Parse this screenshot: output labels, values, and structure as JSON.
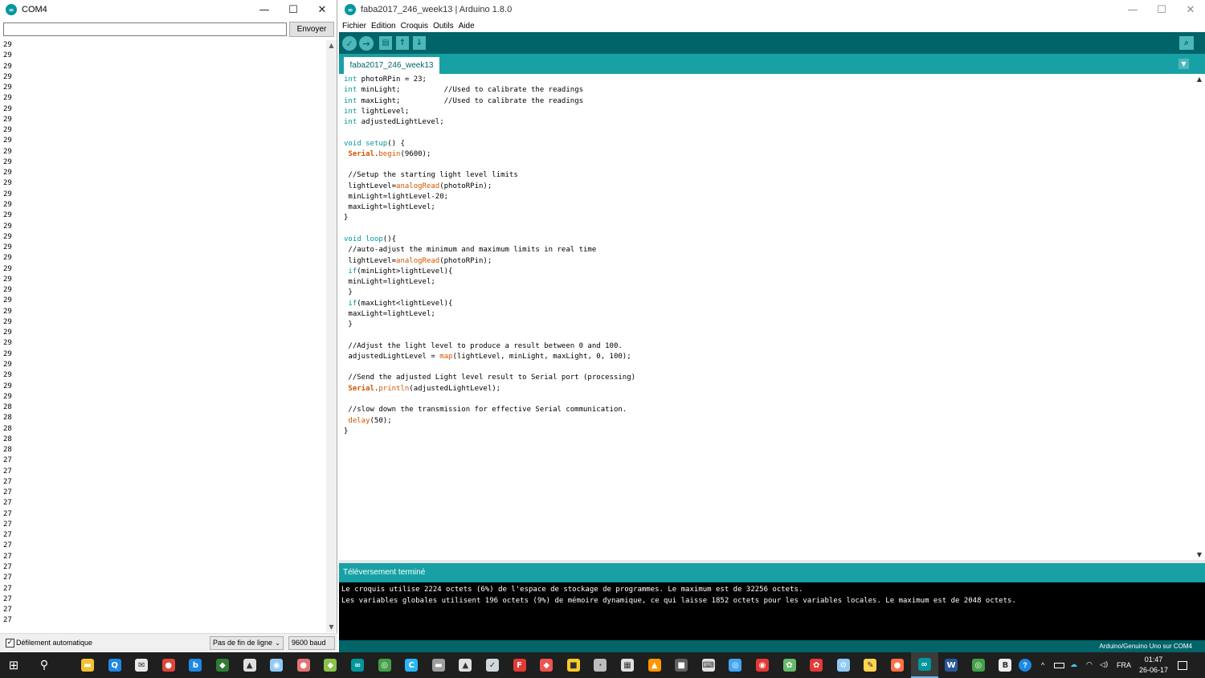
{
  "serial_monitor": {
    "title": "COM4",
    "window_controls": {
      "minimize": "—",
      "maximize": "☐",
      "close": "✕"
    },
    "input": {
      "value": "",
      "placeholder": ""
    },
    "send_label": "Envoyer",
    "output_lines": [
      "29",
      "29",
      "29",
      "29",
      "29",
      "29",
      "29",
      "29",
      "29",
      "29",
      "29",
      "29",
      "29",
      "29",
      "29",
      "29",
      "29",
      "29",
      "29",
      "29",
      "29",
      "29",
      "29",
      "29",
      "29",
      "29",
      "29",
      "29",
      "29",
      "29",
      "29",
      "29",
      "29",
      "29",
      "28",
      "28",
      "28",
      "28",
      "28",
      "27",
      "27",
      "27",
      "27",
      "27",
      "27",
      "27",
      "27",
      "27",
      "27",
      "27",
      "27",
      "27",
      "27",
      "27",
      "27"
    ],
    "autoscroll": {
      "checked": true,
      "label": "Défilement automatique"
    },
    "line_ending": "Pas de fin de ligne",
    "baud": "9600 baud"
  },
  "ide": {
    "title": "faba2017_246_week13 | Arduino 1.8.0",
    "window_controls": {
      "minimize": "—",
      "maximize": "☐",
      "close": "✕"
    },
    "menu": [
      "Fichier",
      "Edition",
      "Croquis",
      "Outils",
      "Aide"
    ],
    "toolbar": {
      "verify": "✓",
      "upload": "→",
      "new": "▤",
      "open": "↑",
      "save": "↓",
      "serial_monitor": "⌕"
    },
    "tab_label": "faba2017_246_week13",
    "tab_menu": "▼",
    "status": "Téléversement terminé",
    "console_lines": [
      "Le croquis utilise 2224 octets (6%) de l'espace de stockage de programmes. Le maximum est de 32256 octets.",
      "Les variables globales utilisent 196 octets (9%) de mémoire dynamique, ce qui laisse 1852 octets pour les variables locales. Le maximum est de 2048 octets."
    ],
    "board": "Arduino/Genuino Uno sur COM4"
  },
  "code_lines": [
    [
      {
        "t": "int",
        "c": "kw"
      },
      {
        "t": " photoRPin = 23;"
      }
    ],
    [
      {
        "t": "int",
        "c": "kw"
      },
      {
        "t": " minLight;          //Used to calibrate the readings"
      }
    ],
    [
      {
        "t": "int",
        "c": "kw"
      },
      {
        "t": " maxLight;          //Used to calibrate the readings"
      }
    ],
    [
      {
        "t": "int",
        "c": "kw"
      },
      {
        "t": " lightLevel;"
      }
    ],
    [
      {
        "t": "int",
        "c": "kw"
      },
      {
        "t": " adjustedLightLevel;"
      }
    ],
    [],
    [
      {
        "t": "void",
        "c": "kw"
      },
      {
        "t": " "
      },
      {
        "t": "setup",
        "c": "kw"
      },
      {
        "t": "() {"
      }
    ],
    [
      {
        "t": " "
      },
      {
        "t": "Serial",
        "c": "ser"
      },
      {
        "t": "."
      },
      {
        "t": "begin",
        "c": "fn"
      },
      {
        "t": "(9600);"
      }
    ],
    [],
    [
      {
        "t": " //Setup the starting light level limits"
      }
    ],
    [
      {
        "t": " lightLevel="
      },
      {
        "t": "analogRead",
        "c": "fn"
      },
      {
        "t": "(photoRPin);"
      }
    ],
    [
      {
        "t": " minLight=lightLevel-20;"
      }
    ],
    [
      {
        "t": " maxLight=lightLevel;"
      }
    ],
    [
      {
        "t": "}"
      }
    ],
    [],
    [
      {
        "t": "void",
        "c": "kw"
      },
      {
        "t": " "
      },
      {
        "t": "loop",
        "c": "kw"
      },
      {
        "t": "(){"
      }
    ],
    [
      {
        "t": " //auto-adjust the minimum and maximum limits in real time"
      }
    ],
    [
      {
        "t": " lightLevel="
      },
      {
        "t": "analogRead",
        "c": "fn"
      },
      {
        "t": "(photoRPin);"
      }
    ],
    [
      {
        "t": " "
      },
      {
        "t": "if",
        "c": "kw"
      },
      {
        "t": "(minLight>lightLevel){"
      }
    ],
    [
      {
        "t": " minLight=lightLevel;"
      }
    ],
    [
      {
        "t": " }"
      }
    ],
    [
      {
        "t": " "
      },
      {
        "t": "if",
        "c": "kw"
      },
      {
        "t": "(maxLight<lightLevel){"
      }
    ],
    [
      {
        "t": " maxLight=lightLevel;"
      }
    ],
    [
      {
        "t": " }"
      }
    ],
    [],
    [
      {
        "t": " //Adjust the light level to produce a result between 0 and 100."
      }
    ],
    [
      {
        "t": " adjustedLightLevel = "
      },
      {
        "t": "map",
        "c": "fn"
      },
      {
        "t": "(lightLevel, minLight, maxLight, 0, 100);"
      }
    ],
    [],
    [
      {
        "t": " //Send the adjusted Light level result to Serial port (processing)"
      }
    ],
    [
      {
        "t": " "
      },
      {
        "t": "Serial",
        "c": "ser"
      },
      {
        "t": "."
      },
      {
        "t": "println",
        "c": "fn"
      },
      {
        "t": "(adjustedLightLevel);"
      }
    ],
    [],
    [
      {
        "t": " //slow down the transmission for effective Serial communication."
      }
    ],
    [
      {
        "t": " "
      },
      {
        "t": "delay",
        "c": "fn"
      },
      {
        "t": "(50);"
      }
    ],
    [
      {
        "t": "}"
      }
    ]
  ],
  "taskbar": {
    "start": "⊞",
    "search": "⚲",
    "apps": [
      {
        "name": "file-explorer",
        "glyph": "▬",
        "color": "#f2c230"
      },
      {
        "name": "search-q",
        "glyph": "Q",
        "color": "#1e88e5"
      },
      {
        "name": "mail",
        "glyph": "✉",
        "color": "#e8e8e8"
      },
      {
        "name": "chrome",
        "glyph": "●",
        "color": "#e0463a"
      },
      {
        "name": "bluetooth",
        "glyph": "b",
        "color": "#1e88e5"
      },
      {
        "name": "photo-app",
        "glyph": "◆",
        "color": "#2e7d32"
      },
      {
        "name": "photos",
        "glyph": "▲",
        "color": "#e0e0e0"
      },
      {
        "name": "inkscape",
        "glyph": "◉",
        "color": "#90caf9"
      },
      {
        "name": "app-red",
        "glyph": "●",
        "color": "#e57373"
      },
      {
        "name": "git",
        "glyph": "◆",
        "color": "#8bc34a"
      },
      {
        "name": "arduino",
        "glyph": "∞",
        "color": "#00979c"
      },
      {
        "name": "app-green",
        "glyph": "◎",
        "color": "#43a047"
      },
      {
        "name": "ccleaner",
        "glyph": "C",
        "color": "#29b6f6"
      },
      {
        "name": "usb-tool",
        "glyph": "▬",
        "color": "#9e9e9e"
      },
      {
        "name": "app-arrow",
        "glyph": "▲",
        "color": "#e0e0e0"
      },
      {
        "name": "app-check",
        "glyph": "✓",
        "color": "#cfd8dc"
      },
      {
        "name": "filezilla",
        "glyph": "F",
        "color": "#e53935"
      },
      {
        "name": "app-gem",
        "glyph": "◆",
        "color": "#ef5350"
      },
      {
        "name": "app-box",
        "glyph": "■",
        "color": "#ffca28"
      },
      {
        "name": "cursor-tool",
        "glyph": "·",
        "color": "#bdbdbd"
      },
      {
        "name": "calculator",
        "glyph": "▦",
        "color": "#e0e0e0"
      },
      {
        "name": "vlc",
        "glyph": "▲",
        "color": "#ff9800"
      },
      {
        "name": "app-dark",
        "glyph": "■",
        "color": "#616161"
      },
      {
        "name": "keyboard",
        "glyph": "⌨",
        "color": "#e0e0e0"
      },
      {
        "name": "app-circle",
        "glyph": "◎",
        "color": "#42a5f5"
      },
      {
        "name": "app-eye",
        "glyph": "◉",
        "color": "#e53935"
      },
      {
        "name": "app-flower",
        "glyph": "✿",
        "color": "#66bb6a"
      },
      {
        "name": "raspberry",
        "glyph": "✿",
        "color": "#e53935"
      },
      {
        "name": "app-gear",
        "glyph": "⚙",
        "color": "#90caf9"
      },
      {
        "name": "app-tools",
        "glyph": "✎",
        "color": "#ffd54f"
      },
      {
        "name": "firefox",
        "glyph": "●",
        "color": "#ff7043"
      },
      {
        "name": "arduino-active",
        "glyph": "∞",
        "color": "#00979c",
        "active": true
      },
      {
        "name": "word",
        "glyph": "W",
        "color": "#2b579a"
      },
      {
        "name": "app-green2",
        "glyph": "◎",
        "color": "#43a047"
      },
      {
        "name": "app-b",
        "glyph": "B",
        "color": "#eeeeee"
      }
    ],
    "tray": {
      "help": "?",
      "chevron": "^",
      "language": "FRA",
      "time": "01:47",
      "date": "26-06-17"
    }
  }
}
